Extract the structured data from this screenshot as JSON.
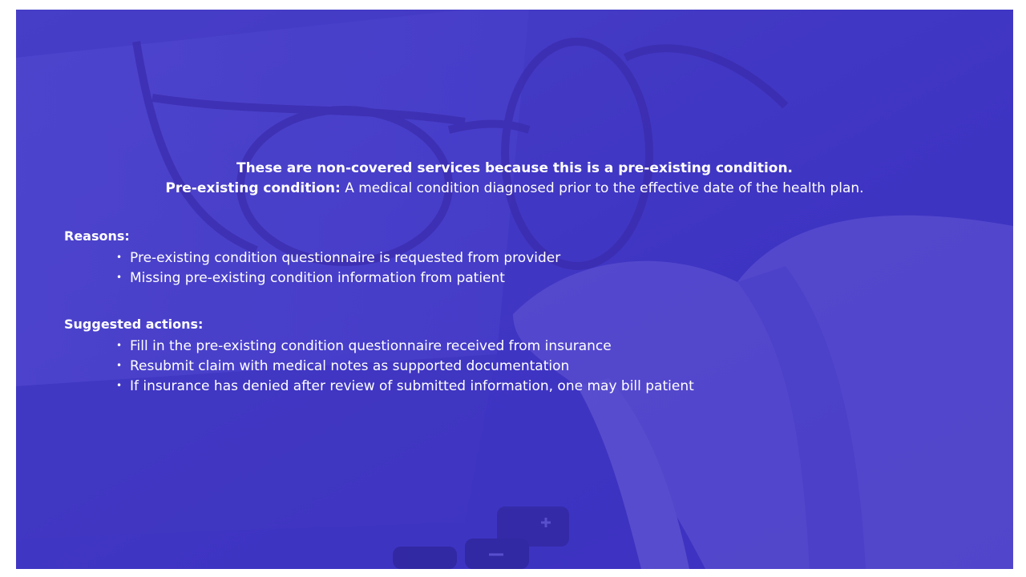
{
  "heading": {
    "line1": "These are non-covered services because this is a pre-existing condition.",
    "term": "Pre-existing condition:",
    "definition": " A medical condition diagnosed prior to the effective date of the health plan."
  },
  "reasons": {
    "title": "Reasons:",
    "items": [
      "Pre-existing condition questionnaire is requested from provider",
      "Missing pre-existing condition information from patient"
    ]
  },
  "suggested_actions": {
    "title": "Suggested actions:",
    "items": [
      "Fill in the pre-existing condition questionnaire received from insurance",
      "Resubmit claim with medical notes as supported documentation",
      "If insurance has denied after review of submitted information, one may bill patient"
    ]
  },
  "colors": {
    "overlay": "#3f35c4",
    "text": "#ffffff"
  }
}
